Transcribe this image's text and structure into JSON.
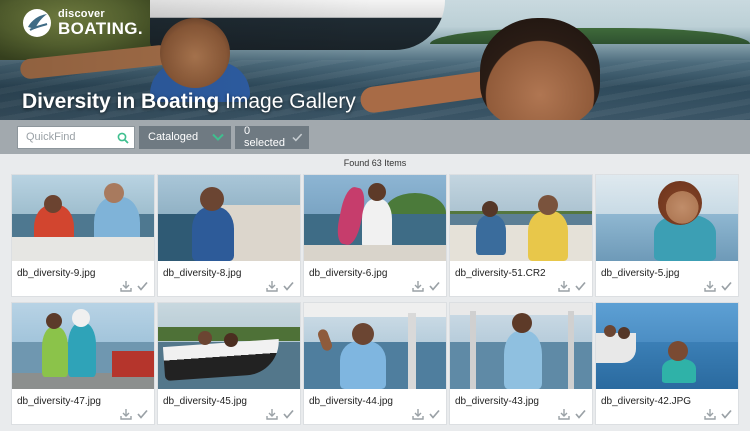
{
  "brand": {
    "line1": "discover",
    "line2": "BOATING."
  },
  "hero": {
    "title_bold": "Diversity in Boating",
    "title_rest": " Image Gallery"
  },
  "toolbar": {
    "search_placeholder": "QuickFind",
    "filter_label": "Cataloged",
    "selected_label": "0 selected"
  },
  "results": {
    "found_text": "Found 63 Items"
  },
  "colors": {
    "accent": "#3fbf8f",
    "toolbar": "#a2a9ae",
    "button": "#6f7a82"
  },
  "items": [
    {
      "filename": "db_diversity-9.jpg"
    },
    {
      "filename": "db_diversity-8.jpg"
    },
    {
      "filename": "db_diversity-6.jpg"
    },
    {
      "filename": "db_diversity-51.CR2"
    },
    {
      "filename": "db_diversity-5.jpg"
    },
    {
      "filename": "db_diversity-47.jpg"
    },
    {
      "filename": "db_diversity-45.jpg"
    },
    {
      "filename": "db_diversity-44.jpg"
    },
    {
      "filename": "db_diversity-43.jpg"
    },
    {
      "filename": "db_diversity-42.JPG"
    }
  ]
}
